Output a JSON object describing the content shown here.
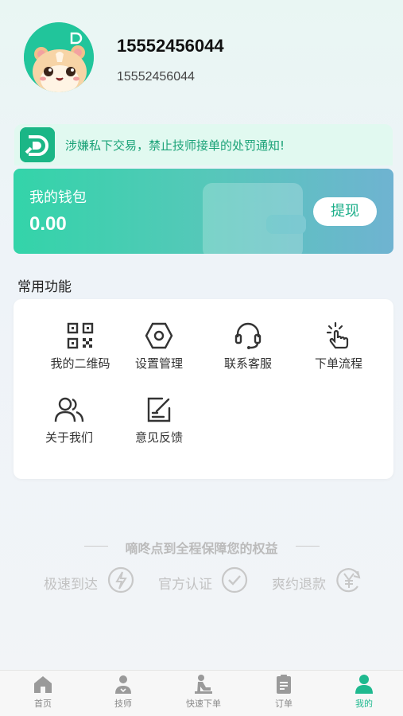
{
  "profile": {
    "phone": "15552456044",
    "subtitle": "15552456044"
  },
  "notice": {
    "text": "涉嫌私下交易，禁止技师接单的处罚通知!"
  },
  "wallet": {
    "title": "我的钱包",
    "balance": "0.00",
    "withdraw_label": "提现"
  },
  "functions": {
    "title": "常用功能",
    "items": [
      {
        "label": "我的二维码",
        "icon": "qr-code-icon"
      },
      {
        "label": "设置管理",
        "icon": "settings-hex-icon"
      },
      {
        "label": "联系客服",
        "icon": "headset-icon"
      },
      {
        "label": "下单流程",
        "icon": "tap-hand-icon"
      },
      {
        "label": "关于我们",
        "icon": "users-icon"
      },
      {
        "label": "意见反馈",
        "icon": "edit-note-icon"
      }
    ]
  },
  "guarantee": {
    "title": "嘀咚点到全程保障您的权益",
    "items": [
      {
        "label": "极速到达",
        "icon": "lightning-icon"
      },
      {
        "label": "官方认证",
        "icon": "check-circle-icon"
      },
      {
        "label": "爽约退款",
        "icon": "yen-refund-icon"
      }
    ]
  },
  "tabbar": {
    "items": [
      {
        "label": "首页",
        "icon": "home-icon"
      },
      {
        "label": "技师",
        "icon": "technician-icon"
      },
      {
        "label": "快速下单",
        "icon": "quick-order-icon"
      },
      {
        "label": "订单",
        "icon": "order-clipboard-icon"
      },
      {
        "label": "我的",
        "icon": "user-icon"
      }
    ],
    "active": "我的"
  },
  "colors": {
    "accent": "#1fb98f",
    "notice_bg": "#e1f9f0",
    "wallet_gradient_start": "#33d4a9",
    "wallet_gradient_end": "#6fb3d1"
  }
}
